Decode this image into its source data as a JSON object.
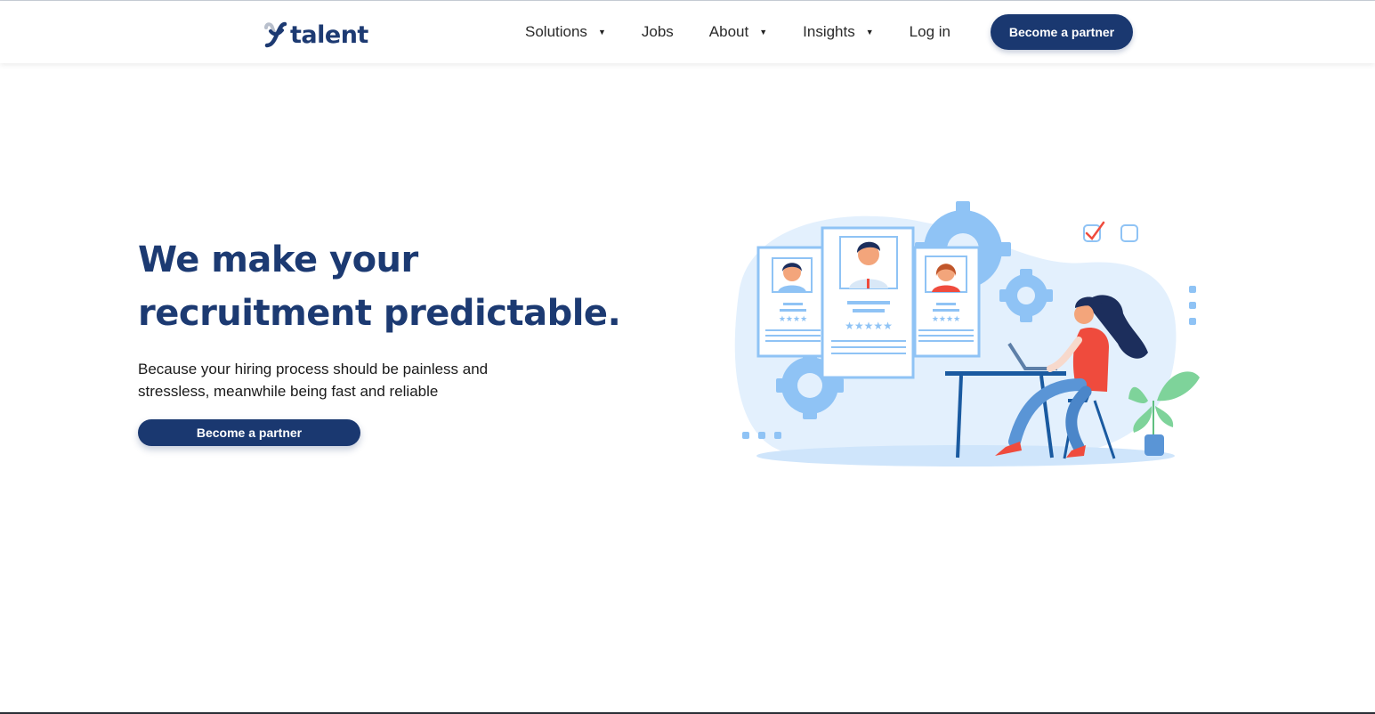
{
  "header": {
    "logo_text": "talent",
    "nav": [
      {
        "label": "Solutions",
        "dropdown": true
      },
      {
        "label": "Jobs",
        "dropdown": false
      },
      {
        "label": "About",
        "dropdown": true
      },
      {
        "label": "Insights",
        "dropdown": true
      },
      {
        "label": "Log in",
        "dropdown": false
      }
    ],
    "cta_label": "Become a partner"
  },
  "hero": {
    "title_line1": "We make your",
    "title_line2": "recruitment predictable.",
    "subtitle_line1": "Because your hiring process should be painless and",
    "subtitle_line2": "stressless, meanwhile being fast and reliable",
    "cta_label": "Become a partner"
  },
  "icons": {
    "caret": "caret-down-icon"
  },
  "colors": {
    "brand_navy": "#1a3870",
    "illustration_light_blue": "#e3f0fd",
    "illustration_blue": "#8fc3f5",
    "accent_red": "#ef4b3d"
  }
}
